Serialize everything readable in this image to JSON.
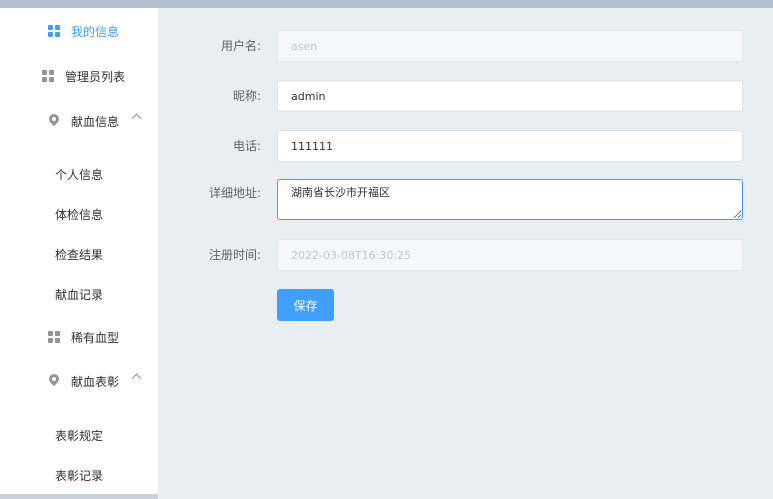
{
  "sidebar": {
    "items": [
      {
        "label": "我的信息",
        "icon": "grid-icon",
        "active": true
      },
      {
        "label": "管理员列表",
        "icon": "grid-icon"
      },
      {
        "label": "献血信息",
        "icon": "location-icon",
        "expanded": true,
        "children": [
          "个人信息",
          "体检信息",
          "检查结果",
          "献血记录"
        ]
      },
      {
        "label": "稀有血型",
        "icon": "grid-icon"
      },
      {
        "label": "献血表彰",
        "icon": "location-icon",
        "expanded": true,
        "children": [
          "表彰规定",
          "表彰记录"
        ]
      }
    ]
  },
  "form": {
    "username_label": "用户名:",
    "username_value": "asen",
    "nickname_label": "昵称:",
    "nickname_value": "admin",
    "phone_label": "电话:",
    "phone_value": "111111",
    "address_label": "详细地址:",
    "address_value": "湖南省长沙市开福区",
    "regtime_label": "注册时间:",
    "regtime_value": "2022-03-08T16:30:25",
    "save_label": "保存"
  },
  "colors": {
    "accent": "#409eff",
    "background": "#e9eef3",
    "topbar": "#b3c0d1"
  }
}
